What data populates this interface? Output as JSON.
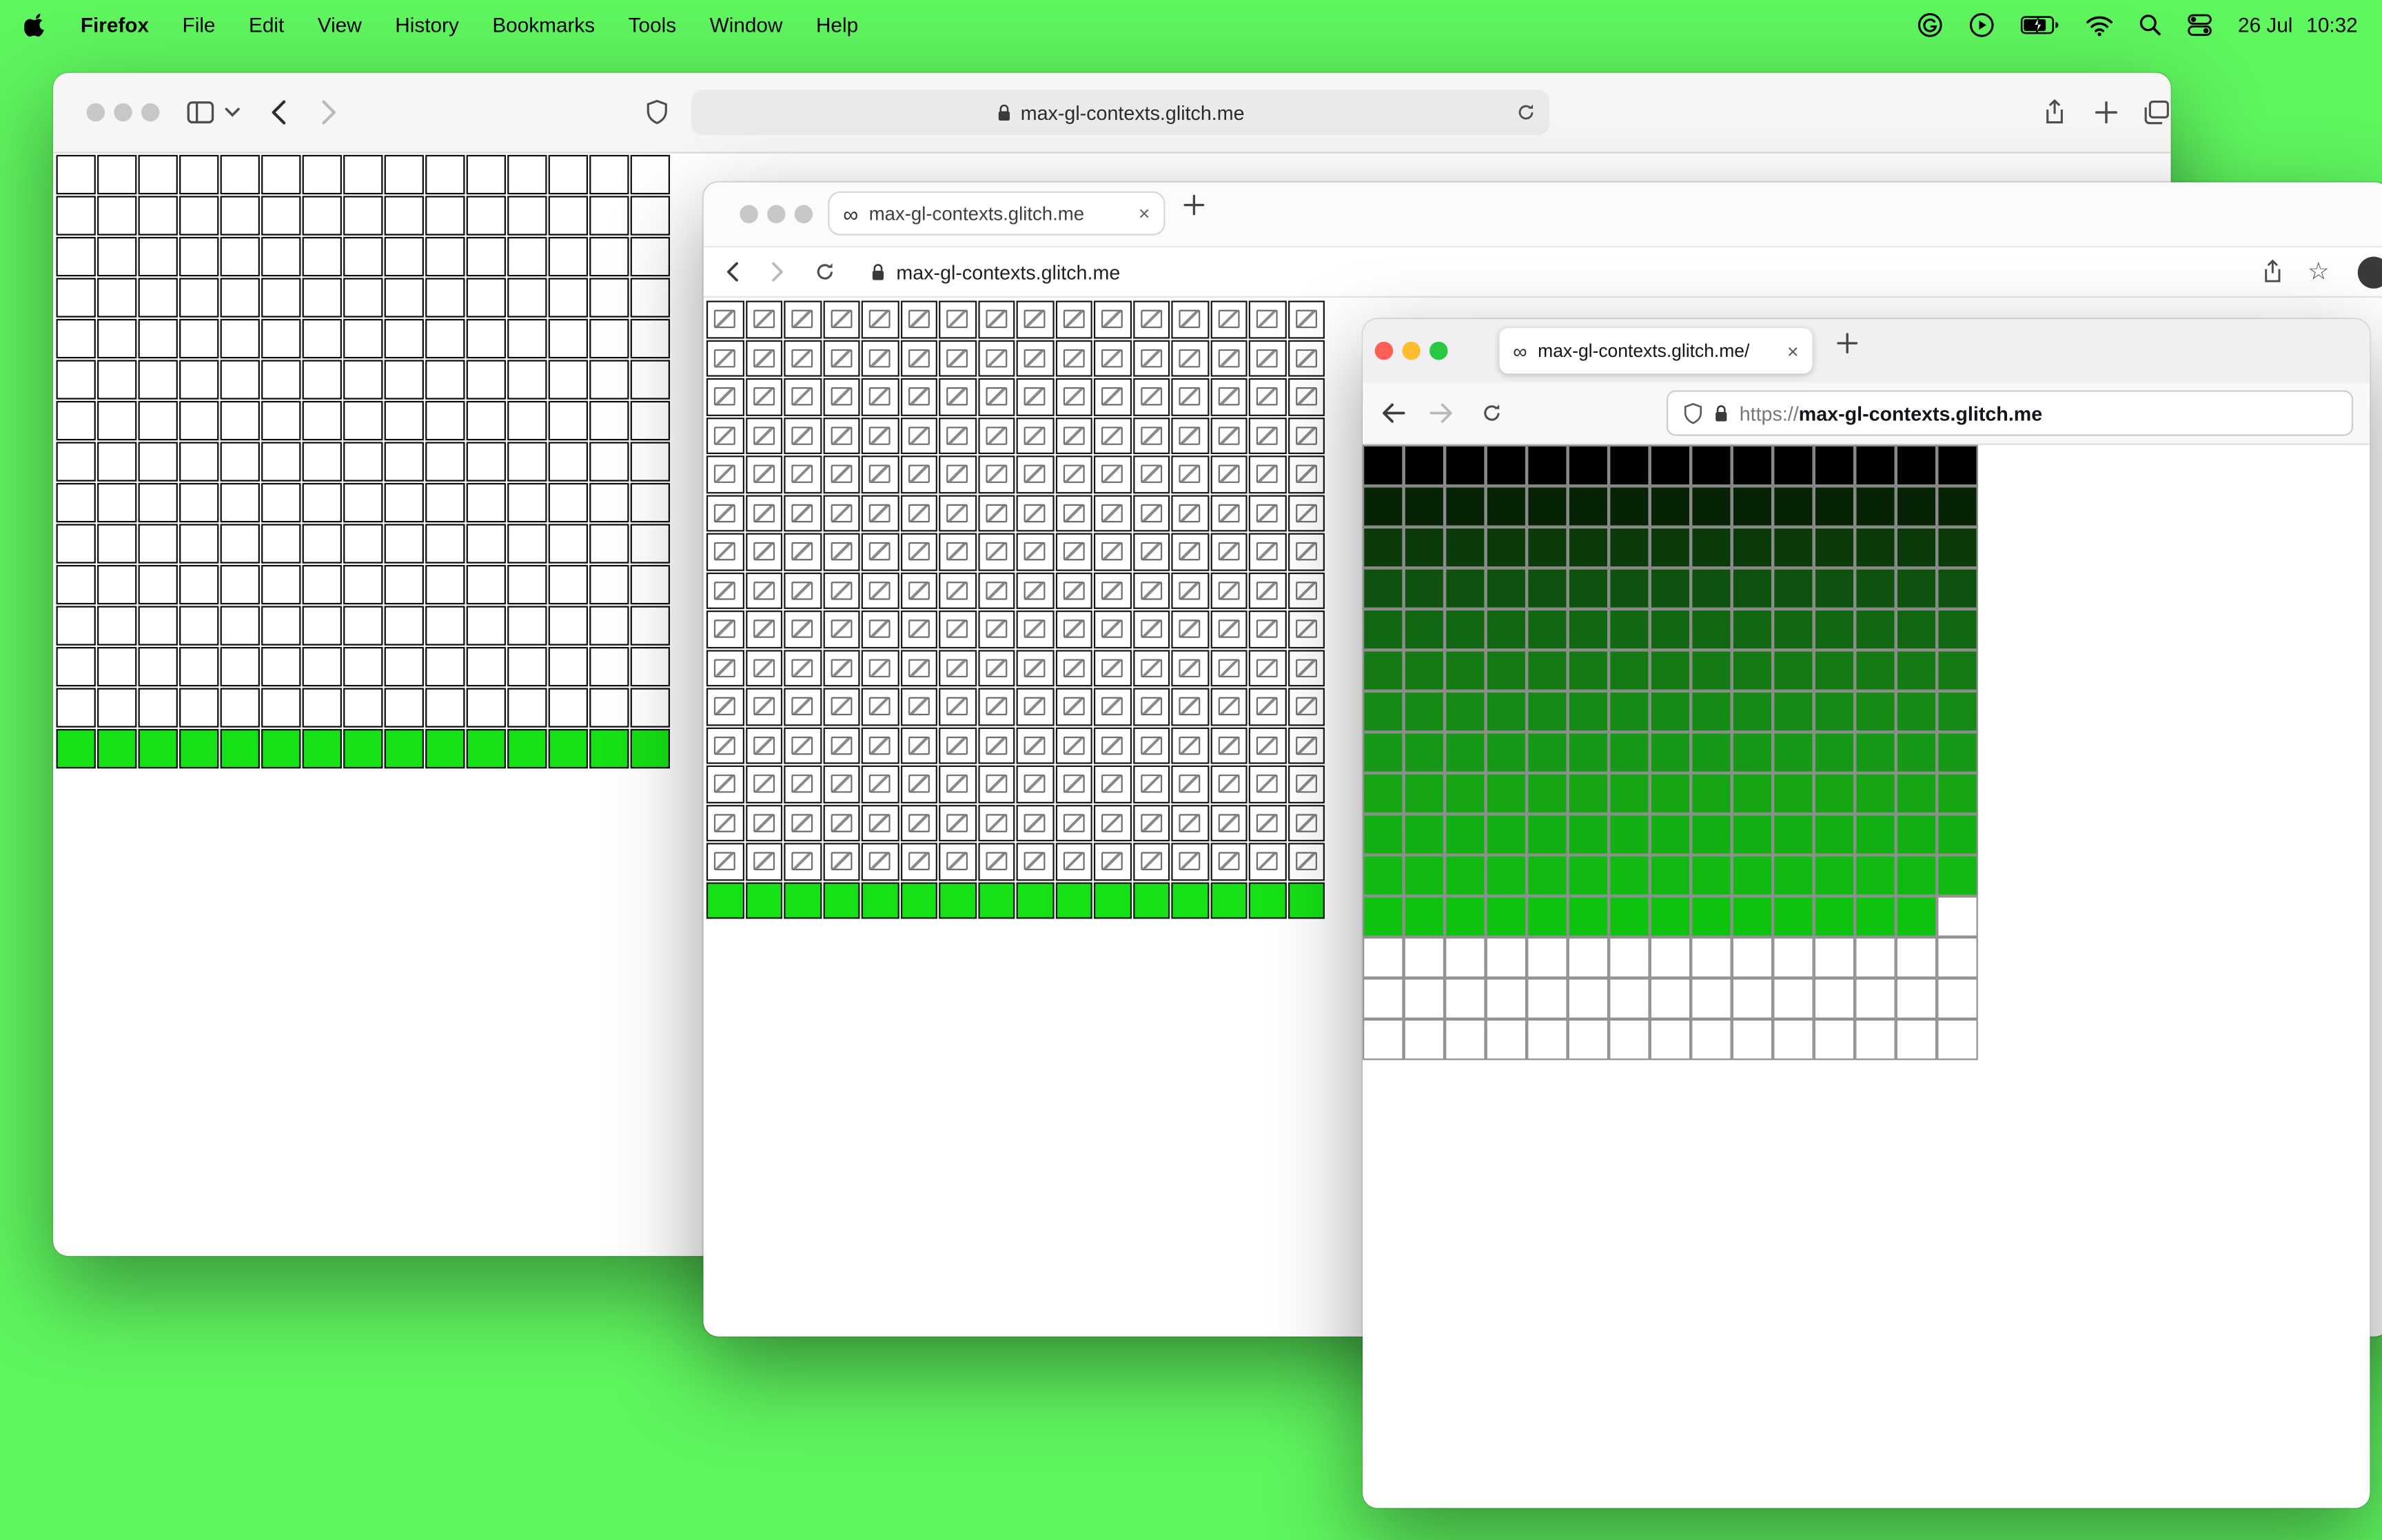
{
  "colors": {
    "desktop_bg": "#5ff55f",
    "cell_green": "#16e016"
  },
  "icons": {
    "infinity": "∞",
    "close": "×",
    "star": "☆"
  },
  "menubar": {
    "app": "Firefox",
    "menus": [
      "File",
      "Edit",
      "View",
      "History",
      "Bookmarks",
      "Tools",
      "Window",
      "Help"
    ],
    "date": "26 Jul",
    "time": "10:32"
  },
  "window_back": {
    "url": "max-gl-contexts.glitch.me",
    "grid": {
      "type": "plain",
      "cols": 15,
      "rows": 15,
      "green_last_rows": 1
    }
  },
  "window_middle": {
    "tab_title": "max-gl-contexts.glitch.me",
    "url": "max-gl-contexts.glitch.me",
    "grid": {
      "type": "broken",
      "cols": 16,
      "rows": 16,
      "green_last_rows": 1
    }
  },
  "window_front": {
    "tab_title": "max-gl-contexts.glitch.me/",
    "url_scheme": "https://",
    "url_host": "max-gl-contexts.glitch.me",
    "grid": {
      "type": "colored",
      "cols": 15,
      "rows": 15,
      "partial": {
        "row": 11,
        "filled": 14
      },
      "row_colors": [
        "#000000",
        "#062306",
        "#0b3b0b",
        "#0f520f",
        "#126712",
        "#147a14",
        "#158b15",
        "#169916",
        "#15a515",
        "#13b013",
        "#10ba10",
        "#0dc30d",
        "#ffffff",
        "#ffffff",
        "#ffffff"
      ]
    }
  }
}
